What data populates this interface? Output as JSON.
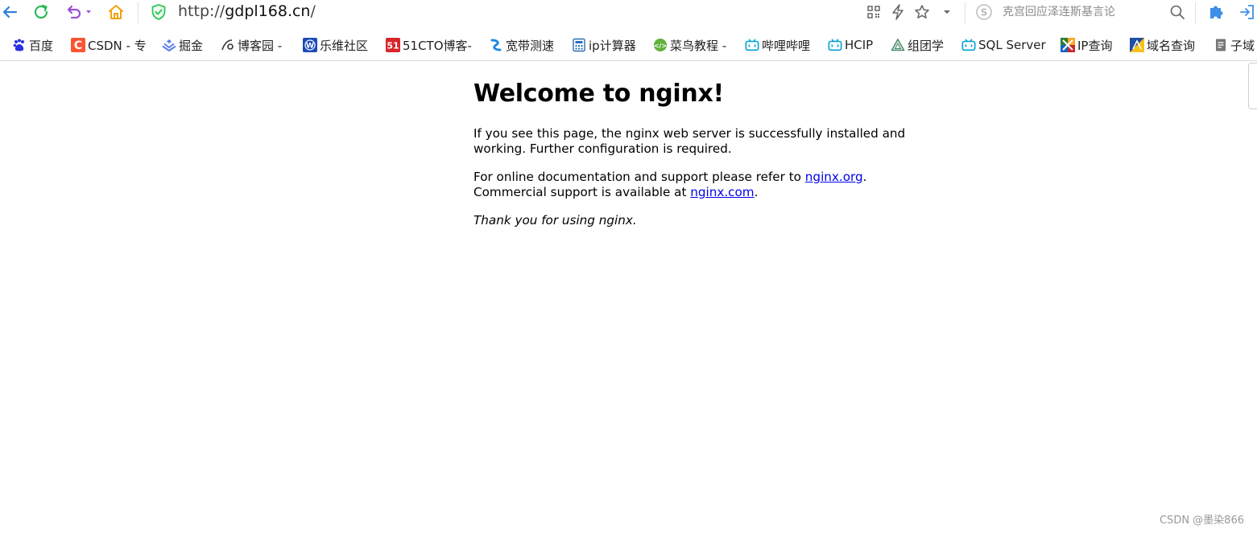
{
  "toolbar": {
    "url_scheme": "http://",
    "url_host": "gdpl168.cn",
    "url_path": "/",
    "search_placeholder": "克宫回应泽连斯基言论"
  },
  "bookmarks": [
    {
      "label": "百度"
    },
    {
      "label": "CSDN - 专"
    },
    {
      "label": "掘金"
    },
    {
      "label": "博客园 -"
    },
    {
      "label": "乐维社区"
    },
    {
      "label": "51CTO博客-"
    },
    {
      "label": "宽带测速"
    },
    {
      "label": "ip计算器"
    },
    {
      "label": "菜鸟教程 -"
    },
    {
      "label": "哔哩哔哩"
    },
    {
      "label": "HCIP"
    },
    {
      "label": "组团学"
    },
    {
      "label": "SQL Server"
    },
    {
      "label": "IP查询"
    },
    {
      "label": "域名查询"
    },
    {
      "label": "子域"
    }
  ],
  "page": {
    "heading": "Welcome to nginx!",
    "p1": "If you see this page, the nginx web server is successfully installed and working. Further configuration is required.",
    "p2_prefix": "For online documentation and support please refer to ",
    "p2_link": "nginx.org",
    "p2_mid": ".",
    "p3_prefix": "Commercial support is available at ",
    "p3_link": "nginx.com",
    "p3_suffix": ".",
    "thanks": "Thank you for using nginx."
  },
  "watermark": "CSDN @墨染866",
  "colors": {
    "back": "#2d7fd9",
    "refresh": "#2bbb55",
    "undo": "#9b4fd8",
    "home": "#f2a20c",
    "shield": "#34c759",
    "link": "#0000ee"
  }
}
